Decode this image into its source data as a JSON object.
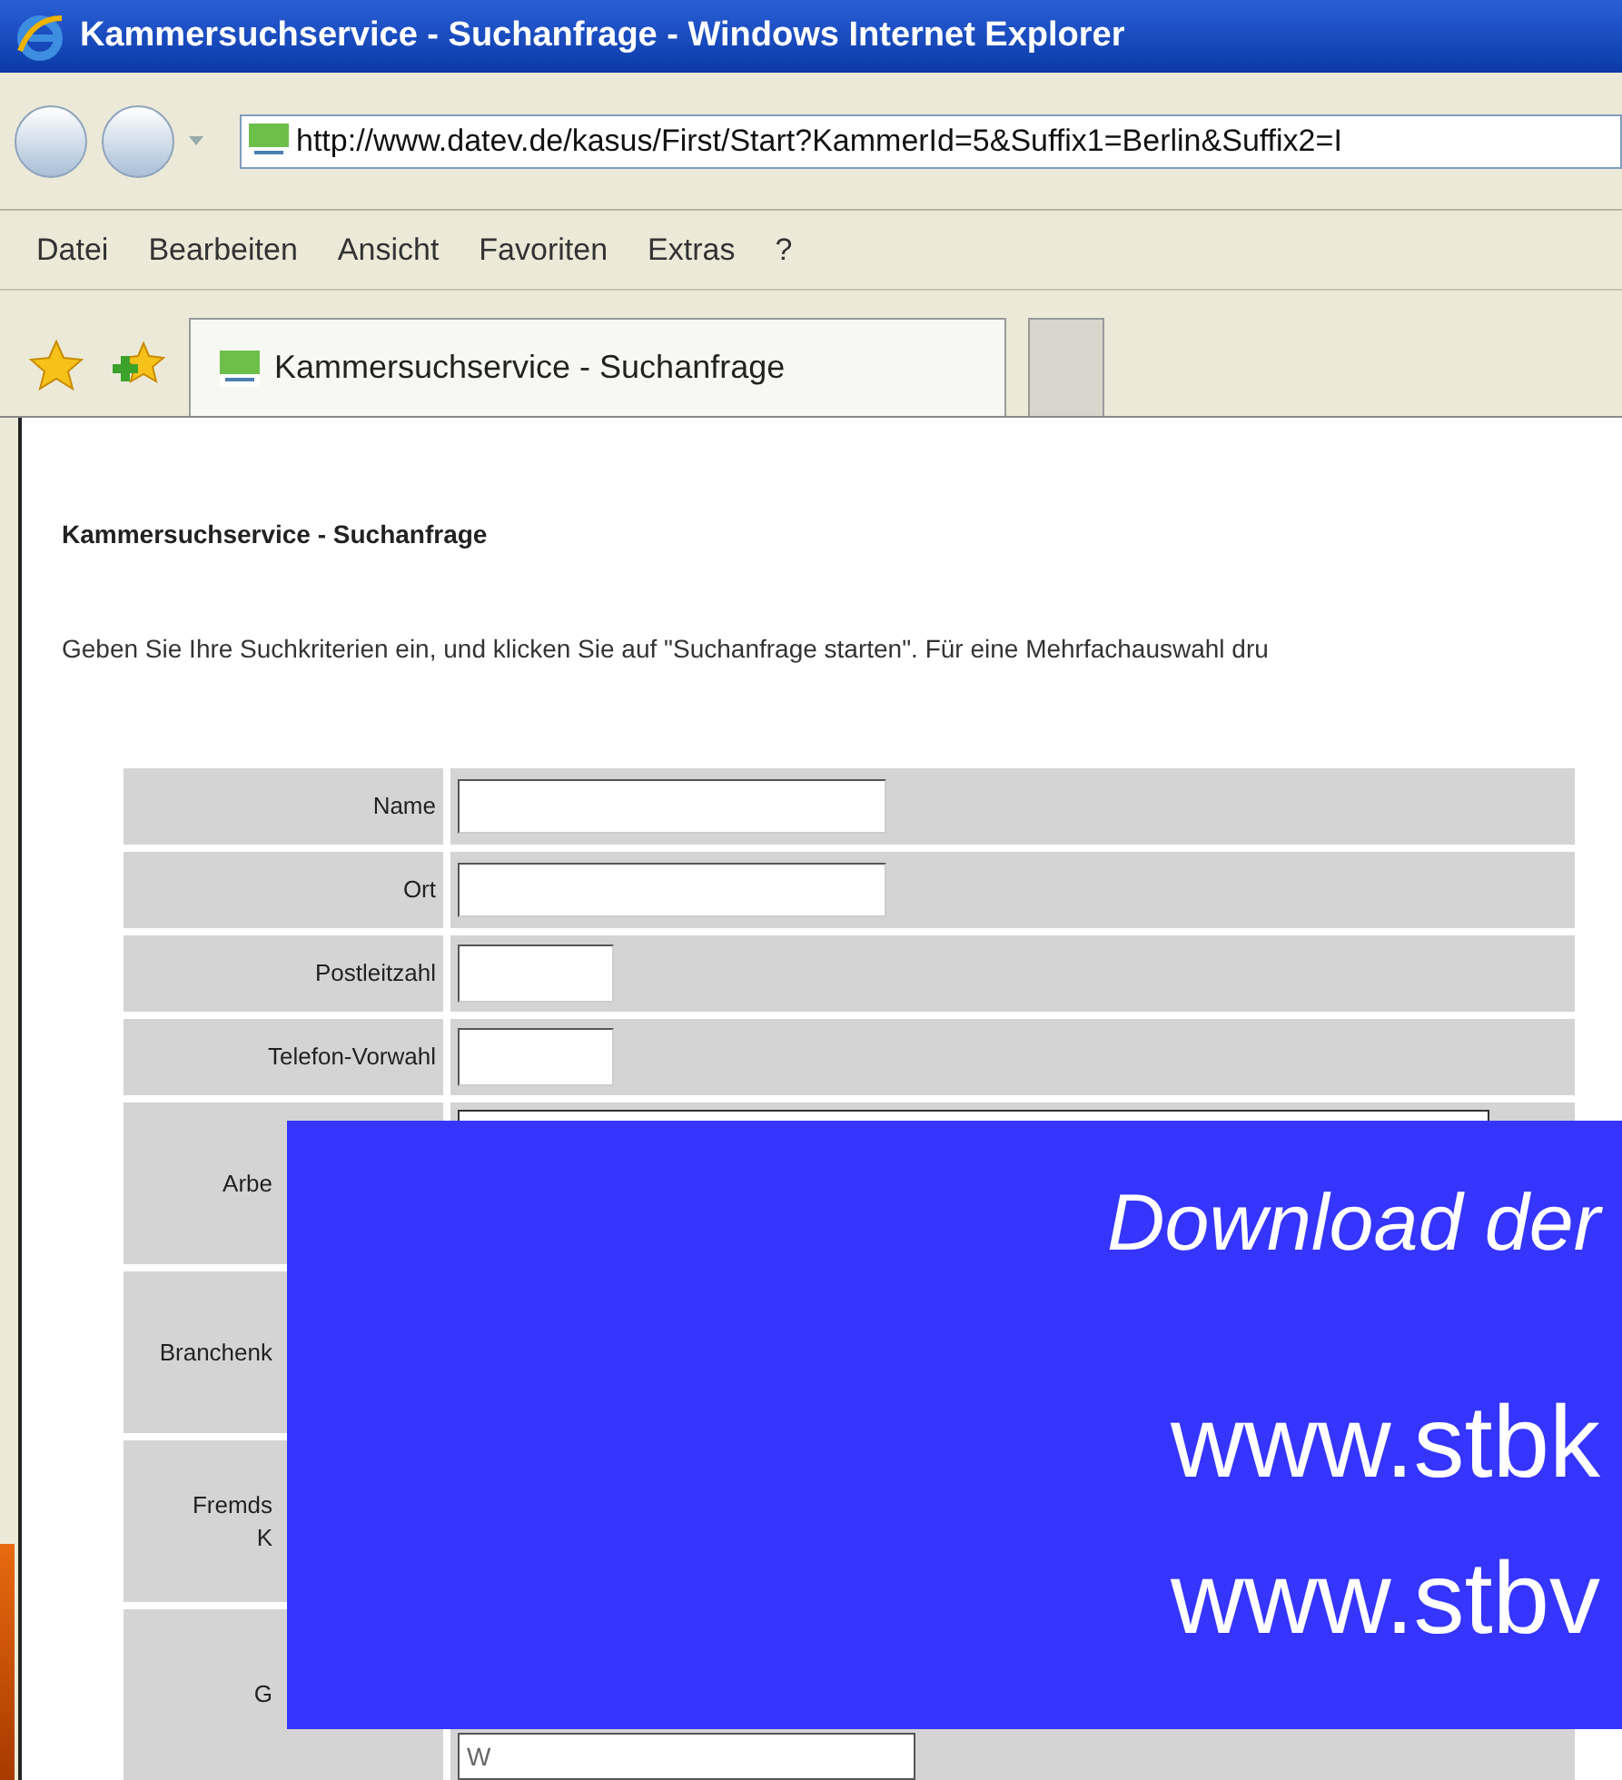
{
  "window": {
    "title": "Kammersuchservice - Suchanfrage - Windows Internet Explorer"
  },
  "address_bar": {
    "value": "http://www.datev.de/kasus/First/Start?KammerId=5&Suffix1=Berlin&Suffix2=I"
  },
  "menu": [
    "Datei",
    "Bearbeiten",
    "Ansicht",
    "Favoriten",
    "Extras",
    "?"
  ],
  "tabs": [
    {
      "label": "Kammersuchservice - Suchanfrage",
      "selected": true
    }
  ],
  "page": {
    "heading": "Kammersuchservice - Suchanfrage",
    "intro": "Geben Sie Ihre Suchkriterien ein, und klicken Sie auf \"Suchanfrage starten\". Für eine Mehrfachauswahl dru",
    "rows": [
      {
        "label": "Name",
        "kind": "wide"
      },
      {
        "label": "Ort",
        "kind": "wide"
      },
      {
        "label": "Postleitzahl",
        "kind": "small"
      },
      {
        "label": "Telefon-Vorwahl",
        "kind": "small"
      },
      {
        "label": "Arbe",
        "kind": "list"
      },
      {
        "label": "Branchenk",
        "kind": "none"
      },
      {
        "label": "Fremds\nK",
        "kind": "none"
      },
      {
        "label": "G",
        "kind": "value",
        "value": "W"
      }
    ]
  },
  "overlay": {
    "title": "Download der",
    "lines": [
      "www.stbk",
      "www.stbv"
    ]
  }
}
